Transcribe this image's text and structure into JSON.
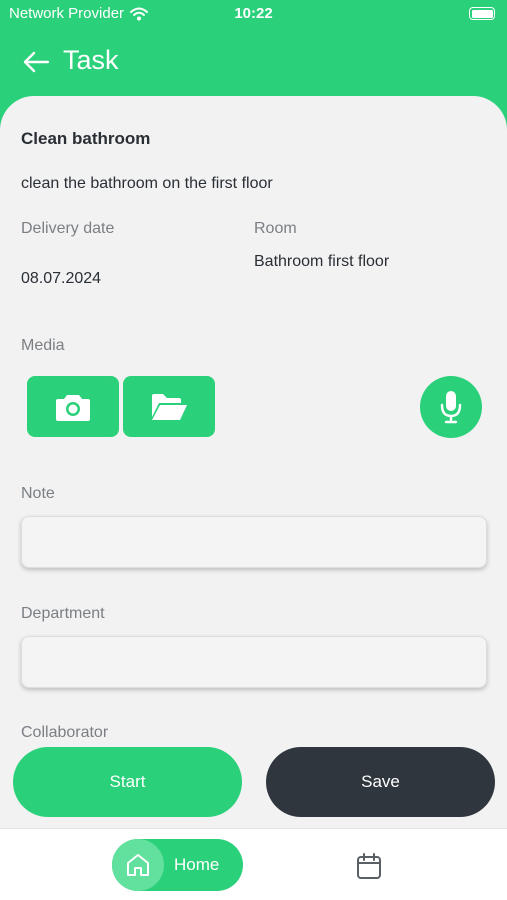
{
  "status_bar": {
    "carrier": "Network Provider",
    "time": "10:22",
    "battery_level": 1.0
  },
  "header": {
    "title": "Task",
    "back_icon": "arrow-left-icon"
  },
  "task": {
    "title": "Clean bathroom",
    "description": "clean the bathroom on the first floor",
    "delivery_date_label": "Delivery date",
    "delivery_date": "08.07.2024",
    "room_label": "Room",
    "room": "Bathroom first floor"
  },
  "media": {
    "label": "Media",
    "buttons": [
      {
        "icon": "camera-icon"
      },
      {
        "icon": "folder-open-icon"
      },
      {
        "icon": "microphone-icon"
      }
    ]
  },
  "form": {
    "note_label": "Note",
    "note_value": "",
    "department_label": "Department",
    "department_value": "",
    "collaborator_label": "Collaborator"
  },
  "actions": {
    "start_label": "Start",
    "save_label": "Save"
  },
  "nav": {
    "items": [
      {
        "label": "Home",
        "icon": "home-icon",
        "active": true
      },
      {
        "icon": "calendar-icon",
        "active": false
      }
    ]
  },
  "colors": {
    "accent": "#2bd07a",
    "dark": "#2f363e",
    "background": "#f2f2f2"
  }
}
